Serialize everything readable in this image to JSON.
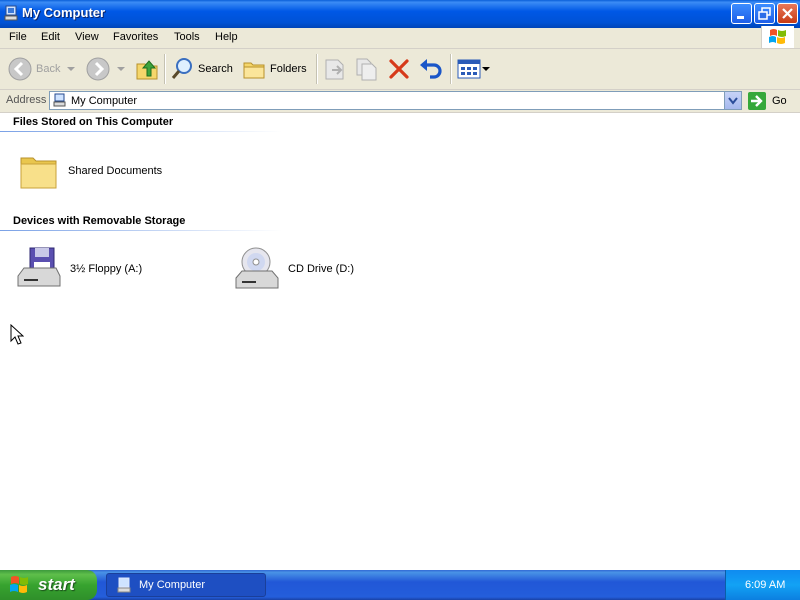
{
  "window": {
    "title": "My Computer"
  },
  "menu": [
    "File",
    "Edit",
    "View",
    "Favorites",
    "Tools",
    "Help"
  ],
  "toolbar": {
    "back": "Back",
    "search": "Search",
    "folders": "Folders"
  },
  "address": {
    "label": "Address",
    "value": "My Computer",
    "go": "Go"
  },
  "groups": [
    {
      "title": "Files Stored on This Computer",
      "items": [
        {
          "label": "Shared Documents",
          "icon": "folder-icon"
        }
      ]
    },
    {
      "title": "Devices with Removable Storage",
      "items": [
        {
          "label": "3½ Floppy (A:)",
          "icon": "floppy-drive-icon"
        },
        {
          "label": "CD Drive (D:)",
          "icon": "cd-drive-icon"
        }
      ]
    }
  ],
  "taskbar": {
    "start": "start",
    "task": "My Computer",
    "clock": "6:09 AM"
  },
  "colors": {
    "titlebar": "#0058e6",
    "taskbar": "#245edb",
    "start": "#37a32f",
    "chrome": "#ece9d8"
  }
}
